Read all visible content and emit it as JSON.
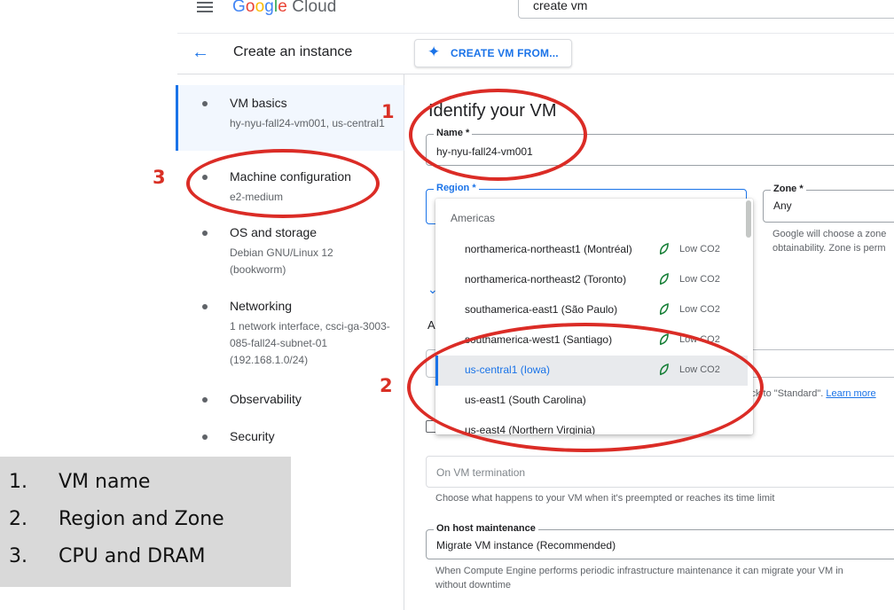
{
  "topbar": {
    "logo_google": "Google",
    "logo_cloud": "Cloud",
    "search_value": "create vm"
  },
  "header": {
    "title": "Create an instance",
    "create_from_label": "CREATE VM FROM..."
  },
  "sidebar": {
    "steps": [
      {
        "title": "VM basics",
        "subtitle": "hy-nyu-fall24-vm001, us-central1"
      },
      {
        "title": "Machine configuration",
        "subtitle": "e2-medium"
      },
      {
        "title": "OS and storage",
        "subtitle": "Debian GNU/Linux 12 (bookworm)"
      },
      {
        "title": "Networking",
        "subtitle": "1 network interface, csci-ga-3003-085-fall24-subnet-01 (192.168.1.0/24)"
      },
      {
        "title": "Observability",
        "subtitle": ""
      },
      {
        "title": "Security",
        "subtitle": ""
      }
    ]
  },
  "main": {
    "heading": "Identify your VM",
    "name_label": "Name *",
    "name_value": "hy-nyu-fall24-vm001",
    "region_label": "Region *",
    "zone_label": "Zone *",
    "zone_value": "Any",
    "zone_help_1": "Google will choose a zone",
    "zone_help_2": "obtainability. Zone is perm",
    "a_letter": "A",
    "stick_note": "tick to \"Standard\". ",
    "learn_more": "Learn more",
    "termination_placeholder": "On VM termination",
    "termination_help": "Choose what happens to your VM when it's preempted or reaches its time limit",
    "host_label": "On host maintenance",
    "host_value": "Migrate VM instance (Recommended)",
    "host_help_1": "When Compute Engine performs periodic infrastructure maintenance it can migrate your VM in",
    "host_help_2": "without downtime"
  },
  "region_dropdown": {
    "group": "Americas",
    "badge": "Low CO2",
    "items": [
      {
        "name": "northamerica-northeast1 (Montréal)",
        "low_co2": true
      },
      {
        "name": "northamerica-northeast2 (Toronto)",
        "low_co2": true
      },
      {
        "name": "southamerica-east1 (São Paulo)",
        "low_co2": true
      },
      {
        "name": "southamerica-west1 (Santiago)",
        "low_co2": true
      },
      {
        "name": "us-central1 (Iowa)",
        "low_co2": true,
        "selected": true
      },
      {
        "name": "us-east1 (South Carolina)",
        "low_co2": false
      },
      {
        "name": "us-east4 (Northern Virginia)",
        "low_co2": false
      }
    ]
  },
  "annotations": {
    "marker_1": "1",
    "marker_2": "2",
    "marker_3": "3",
    "legend": [
      {
        "num": "1.",
        "text": "VM name"
      },
      {
        "num": "2.",
        "text": "Region and Zone"
      },
      {
        "num": "3.",
        "text": "CPU and DRAM"
      }
    ],
    "color": "#db2c26"
  },
  "colors": {
    "accent": "#1a73e8",
    "leaf": "#188038"
  }
}
